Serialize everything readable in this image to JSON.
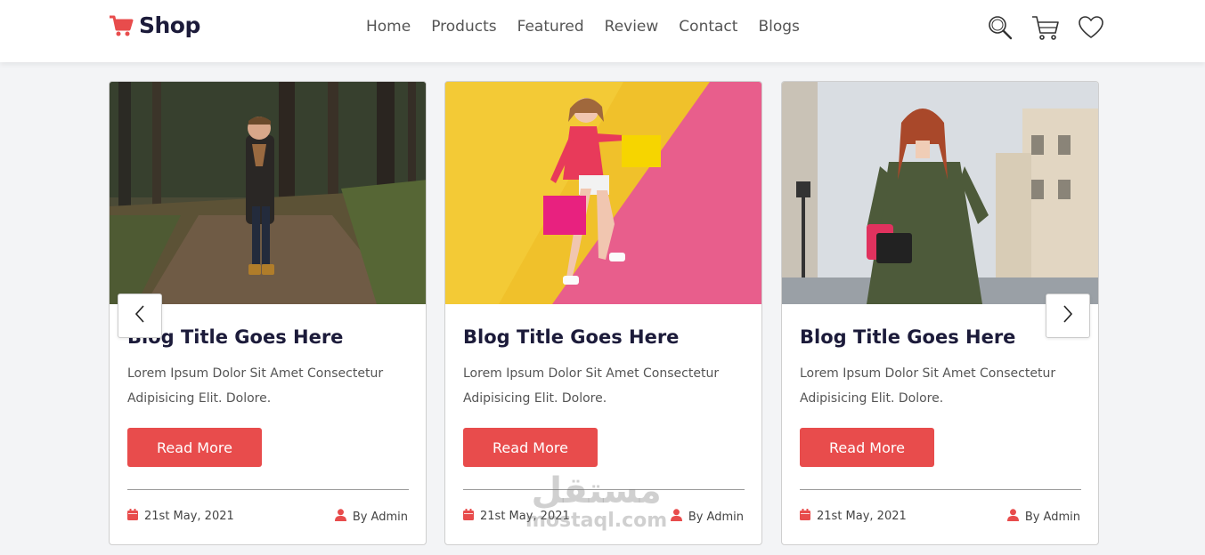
{
  "brand": {
    "name": "Shop",
    "accent": "#e84c4c",
    "dark": "#1c1b3a"
  },
  "nav": [
    {
      "label": "Home"
    },
    {
      "label": "Products"
    },
    {
      "label": "Featured"
    },
    {
      "label": "Review"
    },
    {
      "label": "Contact"
    },
    {
      "label": "Blogs"
    }
  ],
  "header_icons": [
    "search-icon",
    "cart-icon",
    "heart-icon"
  ],
  "cards": [
    {
      "image": "boy-in-forest-photo",
      "title": "Blog Title Goes Here",
      "text": "Lorem Ipsum Dolor Sit Amet Consectetur Adipisicing Elit. Dolore.",
      "button": "Read More",
      "date": "21st May, 2021",
      "author": "By Admin"
    },
    {
      "image": "girl-with-shopping-bags-photo",
      "title": "Blog Title Goes Here",
      "text": "Lorem Ipsum Dolor Sit Amet Consectetur Adipisicing Elit. Dolore.",
      "button": "Read More",
      "date": "21st May, 2021",
      "author": "By Admin"
    },
    {
      "image": "woman-in-green-dress-photo",
      "title": "Blog Title Goes Here",
      "text": "Lorem Ipsum Dolor Sit Amet Consectetur Adipisicing Elit. Dolore.",
      "button": "Read More",
      "date": "21st May, 2021",
      "author": "By Admin"
    }
  ],
  "watermark": {
    "arabic": "مستقل",
    "latin": "mostaql.com"
  }
}
